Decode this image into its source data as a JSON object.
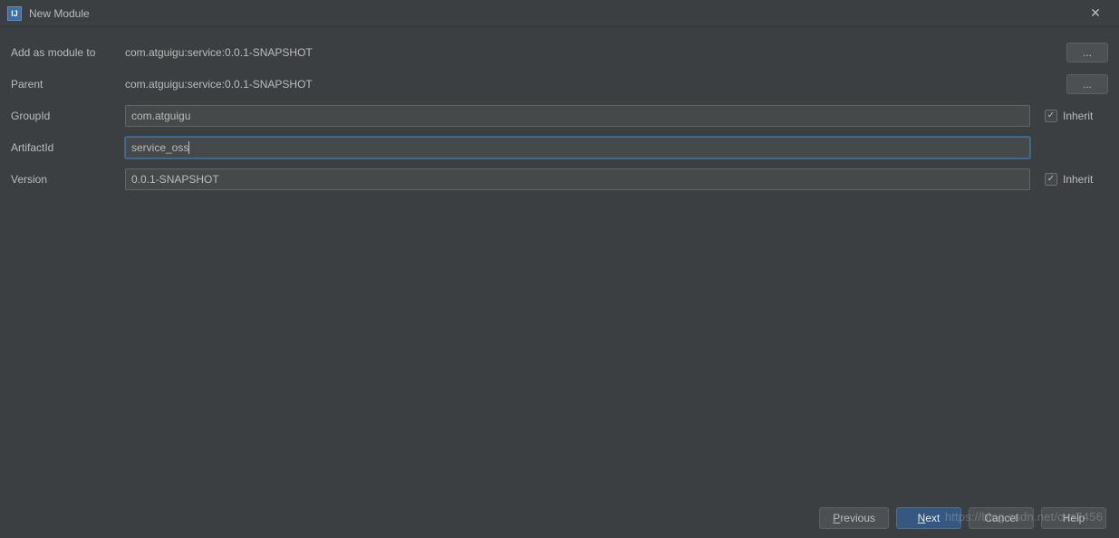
{
  "window": {
    "title": "New Module",
    "icon_label": "IJ"
  },
  "form": {
    "add_as_module": {
      "label": "Add as module to",
      "value": "com.atguigu:service:0.0.1-SNAPSHOT",
      "ellipsis": "..."
    },
    "parent": {
      "label": "Parent",
      "value": "com.atguigu:service:0.0.1-SNAPSHOT",
      "ellipsis": "..."
    },
    "group_id": {
      "label": "GroupId",
      "value": "com.atguigu",
      "inherit_label": "Inherit",
      "inherit_checked": true
    },
    "artifact_id": {
      "label": "ArtifactId",
      "value": "service_oss"
    },
    "version": {
      "label": "Version",
      "value": "0.0.1-SNAPSHOT",
      "inherit_label": "Inherit",
      "inherit_checked": true
    }
  },
  "footer": {
    "previous": "Previous",
    "next": "Next",
    "cancel": "Cancel",
    "help": "Help"
  },
  "checkmark": "✓",
  "close_glyph": "✕",
  "watermark": "https://blog.csdn.net/cxz7456"
}
